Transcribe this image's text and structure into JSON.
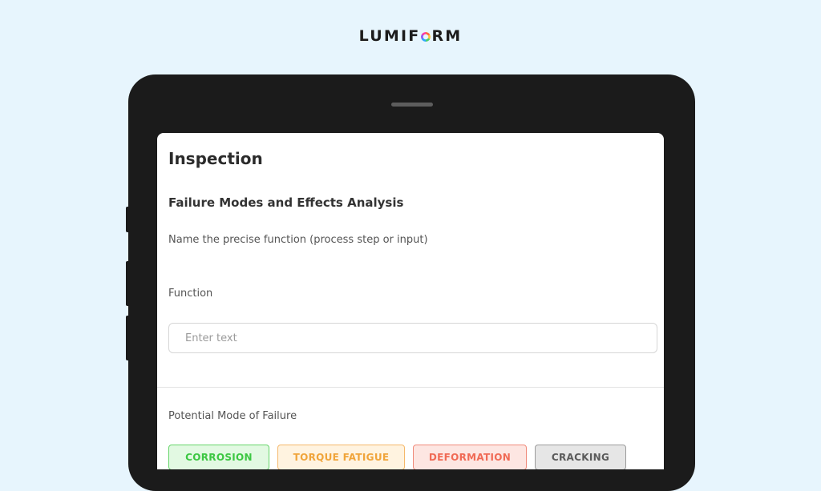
{
  "brand": {
    "name_part1": "LUMIF",
    "name_part2": "RM"
  },
  "form": {
    "title": "Inspection",
    "section_title": "Failure Modes and Effects Analysis",
    "description": "Name the precise function (process step or input)",
    "function_label": "Function",
    "function_placeholder": "Enter text",
    "failure_mode_label": "Potential Mode of Failure",
    "failure_modes": [
      {
        "label": "CORROSION",
        "color": "#3cc742"
      },
      {
        "label": "TORQUE FATIGUE",
        "color": "#f0a43a"
      },
      {
        "label": "DEFORMATION",
        "color": "#f06a55"
      },
      {
        "label": "CRACKING",
        "color": "#5a5a5a"
      }
    ]
  }
}
